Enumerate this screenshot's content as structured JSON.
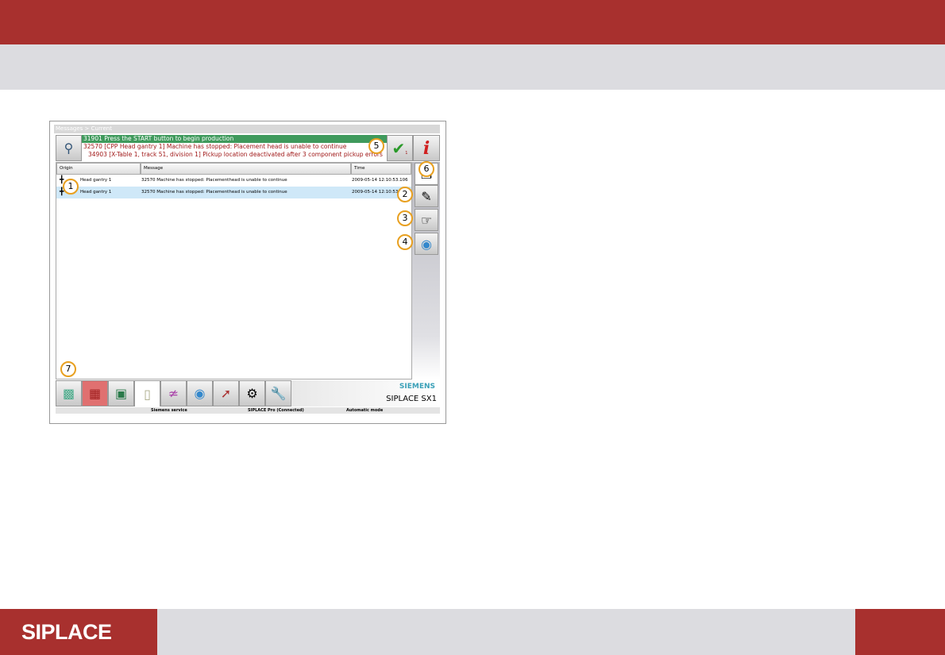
{
  "brand": "SIPLACE",
  "breadcrumb": "Messages > Current",
  "messages": {
    "line1": "31901 Press the START button to begin production",
    "line2": "32570 [CPP Head gantry 1] Machine has stopped: Placement head is unable to continue",
    "line3": "34903 [X-Table 1, track 51, division 1] Pickup location deactivated after 3 component pickup errors",
    "ack_count": "1"
  },
  "table": {
    "columns": [
      "Origin",
      "Message",
      "Time"
    ],
    "rows": [
      {
        "origin": "Head gantry 1",
        "message": "32570 Machine has stopped: Placementhead is unable to continue",
        "time": "2009-05-14 12:10:53.106",
        "selected": false
      },
      {
        "origin": "Head gantry 1",
        "message": "32570 Machine has stopped: Placementhead is unable to continue",
        "time": "2009-05-14 12:10:53",
        "selected": true
      }
    ]
  },
  "callouts": [
    "1",
    "2",
    "3",
    "4",
    "5",
    "6",
    "7"
  ],
  "toolbar": {
    "icons": [
      "production-icon",
      "board-icon",
      "station-icon",
      "messages-icon",
      "chart-icon",
      "camera-icon",
      "nozzle-icon",
      "setup-icon",
      "service-wrench-icon"
    ]
  },
  "machine": {
    "vendor": "SIEMENS",
    "model": "SIPLACE SX1"
  },
  "status": {
    "user": "Siemens service",
    "connection": "SIPLACE Pro (Connected)",
    "mode": "Automatic mode"
  },
  "colors": {
    "brand_red": "#a8302e",
    "message_green": "#3f9a5c",
    "error_text": "#a01818",
    "vendor_teal": "#3aa0b8",
    "selected_row": "#cfe8f8"
  }
}
